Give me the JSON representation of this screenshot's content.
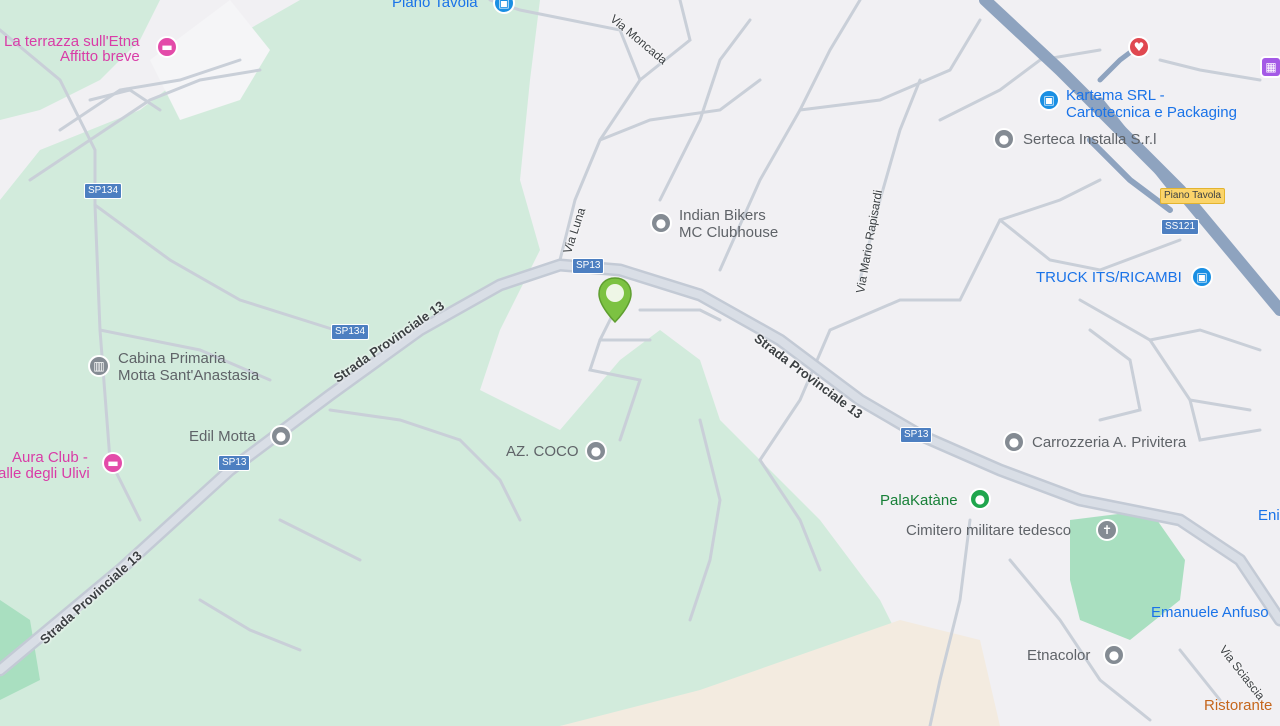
{
  "map": {
    "colors": {
      "background": "#f1f0f3",
      "park": "#cfeadb",
      "park_dark": "#a8dfc0",
      "road": "#c6ccd6",
      "highway": "#8fa4c0",
      "sand": "#f4ece0"
    },
    "selected_marker": {
      "icon": "map-pin-icon",
      "color": "#7cc242"
    }
  },
  "places": [
    {
      "id": "la-terrazza",
      "line1": "La terrazza sull'Etna",
      "line2": "Affitto breve",
      "icon": "hotel-icon",
      "color": "#e34ba9"
    },
    {
      "id": "piano-tavola-top",
      "line1": "Piano Tavola",
      "line2": "",
      "icon": "shopping-bag-icon",
      "color": "#1a8fe3"
    },
    {
      "id": "kartema",
      "line1": "Kartema SRL -",
      "line2": "Cartotecnica e Packaging",
      "icon": "shopping-bag-icon",
      "color": "#1a8fe3"
    },
    {
      "id": "serteca",
      "line1": "Serteca Installa S.r.l",
      "line2": "",
      "icon": "place-icon",
      "color": "#848b93"
    },
    {
      "id": "indian-bikers",
      "line1": "Indian Bikers",
      "line2": "MC Clubhouse",
      "icon": "place-icon",
      "color": "#848b93"
    },
    {
      "id": "truck-its",
      "line1": "TRUCK ITS/RICAMBI",
      "line2": "",
      "icon": "shopping-bag-icon",
      "color": "#1a8fe3"
    },
    {
      "id": "cabina",
      "line1": "Cabina Primaria",
      "line2": "Motta Sant'Anastasia",
      "icon": "building-icon",
      "color": "#848b93"
    },
    {
      "id": "edil-motta",
      "line1": "Edil Motta",
      "line2": "",
      "icon": "place-icon",
      "color": "#848b93"
    },
    {
      "id": "aura-club",
      "line1": "Aura Club -",
      "line2": "alle degli Ulivi",
      "icon": "hotel-icon",
      "color": "#e34ba9"
    },
    {
      "id": "az-coco",
      "line1": "AZ. COCO",
      "line2": "",
      "icon": "place-icon",
      "color": "#848b93"
    },
    {
      "id": "carrozzeria",
      "line1": "Carrozzeria A. Privitera",
      "line2": "",
      "icon": "place-icon",
      "color": "#848b93"
    },
    {
      "id": "palakatane",
      "line1": "PalaKatàne",
      "line2": "",
      "icon": "stadium-icon",
      "color": "#1fa64d"
    },
    {
      "id": "cimitero",
      "line1": "Cimitero militare tedesco",
      "line2": "",
      "icon": "cemetery-icon",
      "color": "#848b93"
    },
    {
      "id": "eni",
      "line1": "Eni",
      "line2": "",
      "icon": "",
      "color": "#1a73e8"
    },
    {
      "id": "emanuele",
      "line1": "Emanuele Anfuso",
      "line2": "",
      "icon": "",
      "color": "#1a73e8"
    },
    {
      "id": "etnacolor",
      "line1": "Etnacolor",
      "line2": "",
      "icon": "place-icon",
      "color": "#848b93"
    },
    {
      "id": "ristorante",
      "line1": "Ristorante",
      "line2": "",
      "icon": "",
      "color": "#c5661c"
    }
  ],
  "roads": {
    "strada_provinciale_13": "Strada Provinciale 13",
    "via_luna": "Via Luna",
    "via_moncada": "Via Moncada",
    "via_mario_rapisardi": "Via Mario Rapisardi",
    "via_sciascia": "Via Sciascia"
  },
  "shields": {
    "sp134": "SP134",
    "sp13": "SP13",
    "ss121": "SS121",
    "piano_tavola": "Piano Tavola"
  }
}
